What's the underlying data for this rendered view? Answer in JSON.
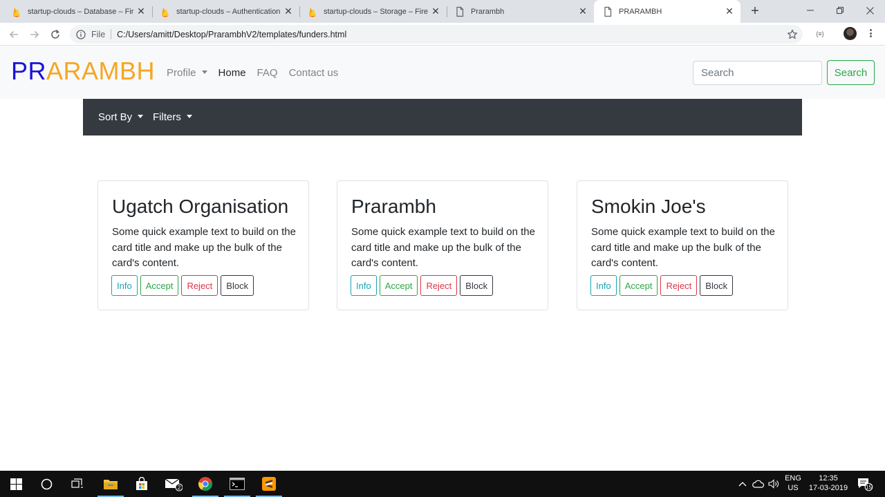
{
  "browser": {
    "tabs": [
      {
        "title": "startup-clouds – Database – Fir",
        "favicon": "firebase-icon",
        "active": false
      },
      {
        "title": "startup-clouds – Authentication",
        "favicon": "firebase-icon",
        "active": false
      },
      {
        "title": "startup-clouds – Storage – Fire",
        "favicon": "firebase-icon",
        "active": false
      },
      {
        "title": "Prarambh",
        "favicon": "page-icon",
        "active": false
      },
      {
        "title": "PRARAMBH",
        "favicon": "page-icon",
        "active": true
      }
    ],
    "address": {
      "scheme_label": "File",
      "url": "C:/Users/amitt/Desktop/PrarambhV2/templates/funders.html"
    }
  },
  "site": {
    "brand_part1": "PR",
    "brand_part2": "ARAMBH",
    "brand_colors": {
      "part1": "#1a12d9",
      "part2": "#f5a623"
    },
    "nav": {
      "profile": "Profile",
      "home": "Home",
      "faq": "FAQ",
      "contact": "Contact us"
    },
    "search": {
      "placeholder": "Search",
      "button": "Search"
    },
    "subnav": {
      "sort_by": "Sort By",
      "filters": "Filters"
    }
  },
  "cards": [
    {
      "title": "Ugatch Organisation",
      "text": "Some quick example text to build on the card title and make up the bulk of the card's content.",
      "buttons": {
        "info": "Info",
        "accept": "Accept",
        "reject": "Reject",
        "block": "Block"
      }
    },
    {
      "title": "Prarambh",
      "text": "Some quick example text to build on the card title and make up the bulk of the card's content.",
      "buttons": {
        "info": "Info",
        "accept": "Accept",
        "reject": "Reject",
        "block": "Block"
      }
    },
    {
      "title": "Smokin Joe's",
      "text": "Some quick example text to build on the card title and make up the bulk of the card's content.",
      "buttons": {
        "info": "Info",
        "accept": "Accept",
        "reject": "Reject",
        "block": "Block"
      }
    }
  ],
  "taskbar": {
    "mail_badge": "2",
    "language": "ENG",
    "region": "US",
    "time": "12:35",
    "date": "17-03-2019",
    "notification_count": "15"
  }
}
